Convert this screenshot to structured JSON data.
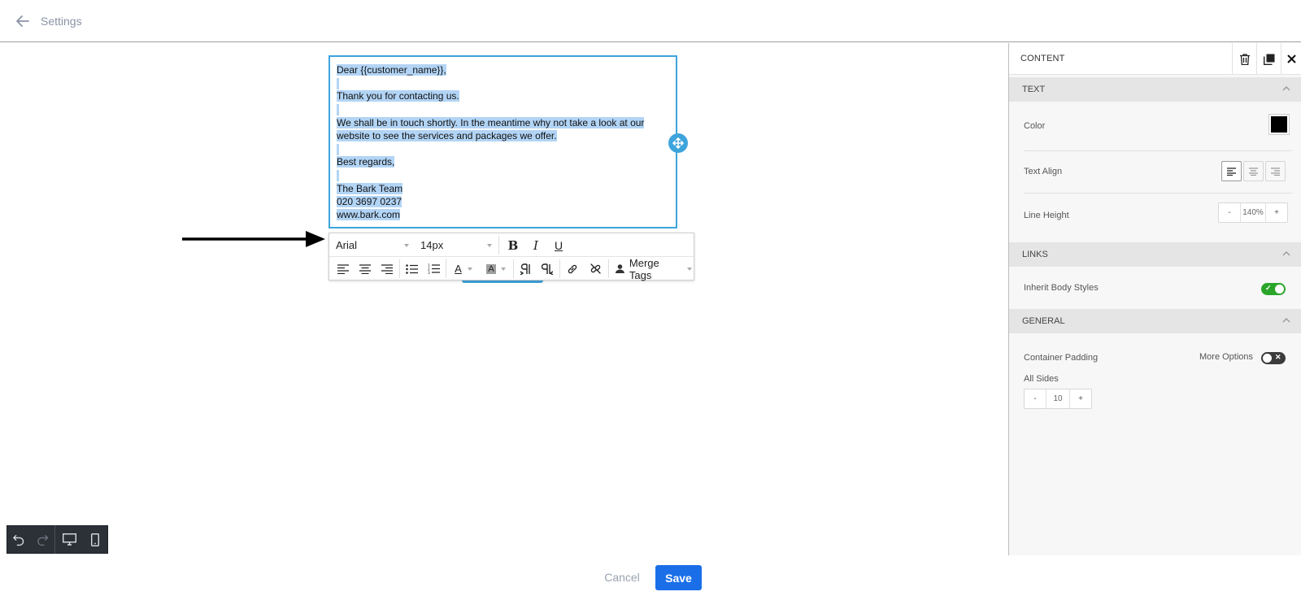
{
  "header": {
    "back_icon": "arrow-left-icon",
    "title": "Settings"
  },
  "editor": {
    "lines": [
      {
        "text": "Dear {{customer_name}},",
        "selected": true
      },
      {
        "text": "",
        "selected": true
      },
      {
        "text": "Thank you for contacting us.",
        "selected": true
      },
      {
        "text": "",
        "selected": true
      },
      {
        "text": "We shall be in touch shortly. In the meantime why not take a look at our",
        "selected": true
      },
      {
        "text": "website to see the services and packages we offer.",
        "selected": true
      },
      {
        "text": "",
        "selected": true
      },
      {
        "text": "Best regards,",
        "selected": true
      },
      {
        "text": "",
        "selected": true
      },
      {
        "text": "The Bark Team",
        "selected": true
      },
      {
        "text": "020 3697 0237",
        "selected": true
      },
      {
        "text": "www.bark.com",
        "selected": true
      }
    ],
    "selection_color": "#b2d4f5",
    "border_color": "#3ea4dc"
  },
  "toolbar": {
    "font_family": "Arial",
    "font_size": "14px",
    "bold_label": "B",
    "italic_label": "I",
    "underline_label": "U",
    "text_color_label": "A",
    "bg_color_label": "A",
    "merge_tags_label": "Merge Tags"
  },
  "panel": {
    "title": "CONTENT",
    "sections": {
      "text": "TEXT",
      "links": "LINKS",
      "general": "GENERAL"
    },
    "color_label": "Color",
    "color_value": "#000000",
    "text_align_label": "Text Align",
    "line_height_label": "Line Height",
    "line_height_value": "140%",
    "minus": "-",
    "plus": "+",
    "inherit_label": "Inherit Body Styles",
    "inherit_on": true,
    "container_padding_label": "Container Padding",
    "more_options_label": "More Options",
    "more_options_on": false,
    "all_sides_label": "All Sides",
    "padding_value": "10"
  },
  "footer": {
    "cancel_label": "Cancel",
    "save_label": "Save",
    "save_color": "#1a6fe8"
  }
}
